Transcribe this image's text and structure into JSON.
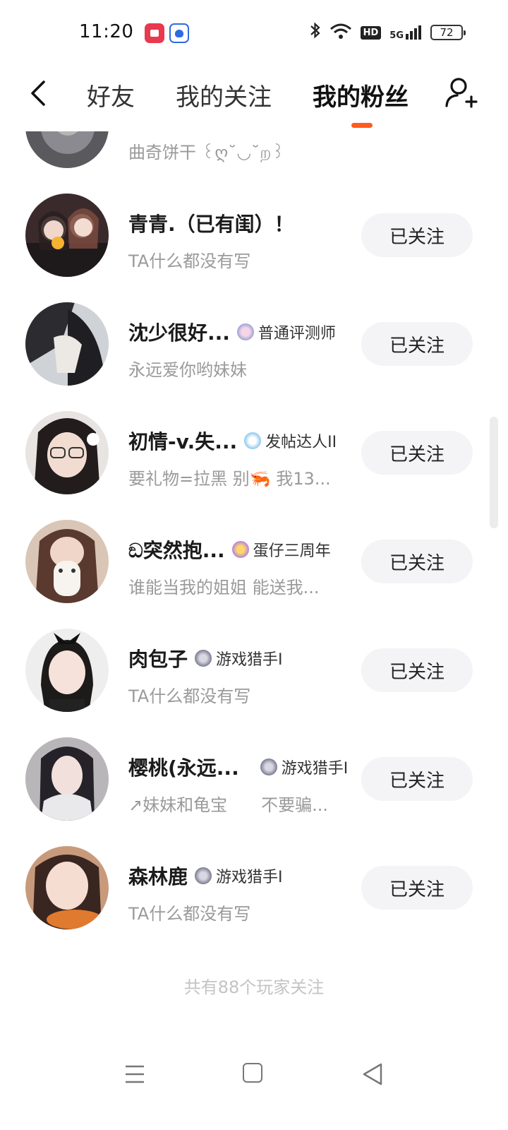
{
  "status_bar": {
    "time": "11:20",
    "network": "5G",
    "hd": "HD",
    "battery": "72"
  },
  "nav": {
    "tabs": [
      {
        "label": "好友"
      },
      {
        "label": "我的关注"
      },
      {
        "label": "我的粉丝"
      }
    ],
    "active_tab": "我的粉丝",
    "accent_color": "#ff5a1f"
  },
  "list": {
    "items": [
      {
        "name": "",
        "badge": "",
        "signature": "曲奇饼干 ꒰ღ˘◡˘ற꒱",
        "button": ""
      },
      {
        "name": "青青.（已有闺）！",
        "badge": "",
        "signature": "TA什么都没有写",
        "button": "已关注"
      },
      {
        "name": "沈少很好...",
        "badge": "普通评测师",
        "signature": "永远爱你哟妹妹",
        "button": "已关注"
      },
      {
        "name": "初情-v.失...",
        "badge": "发帖达人II",
        "signature": "要礼物=拉黑 别🦐 我13...",
        "button": "已关注"
      },
      {
        "name": "ඞ突然抱...",
        "badge": "蛋仔三周年",
        "signature": "谁能当我的姐姐 能送我...",
        "button": "已关注"
      },
      {
        "name": "肉包子",
        "badge": "游戏猎手I",
        "signature": "TA什么都没有写",
        "button": "已关注"
      },
      {
        "name": "樱桃(永远...",
        "badge": "游戏猎手I",
        "signature": "↗妹妹和龟宝　　不要骗...",
        "button": "已关注"
      },
      {
        "name": "森林鹿",
        "badge": "游戏猎手I",
        "signature": "TA什么都没有写",
        "button": "已关注"
      }
    ]
  },
  "footer": {
    "note": "共有88个玩家关注"
  }
}
